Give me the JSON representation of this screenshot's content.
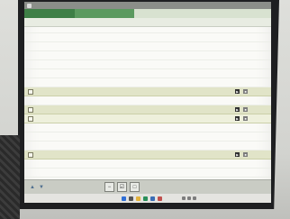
{
  "window": {
    "title": ""
  },
  "tabs": [
    {
      "label": ""
    },
    {
      "label": ""
    }
  ],
  "columns": {
    "c1": "",
    "c2": "",
    "c3": ""
  },
  "rows": [
    {
      "kind": "plain",
      "text": ""
    },
    {
      "kind": "plain",
      "text": ""
    },
    {
      "kind": "plain",
      "text": ""
    },
    {
      "kind": "plain",
      "text": ""
    },
    {
      "kind": "plain",
      "text": ""
    },
    {
      "kind": "plain",
      "text": ""
    },
    {
      "kind": "band",
      "label": "",
      "text": ""
    },
    {
      "kind": "plain",
      "text": ""
    },
    {
      "kind": "band",
      "label": "",
      "text": ""
    },
    {
      "kind": "band",
      "label": "",
      "text": ""
    },
    {
      "kind": "indent",
      "text": ""
    },
    {
      "kind": "indent",
      "text": ""
    },
    {
      "kind": "indent",
      "text": ""
    },
    {
      "kind": "band",
      "label": "",
      "text": ""
    },
    {
      "kind": "indent",
      "text": ""
    },
    {
      "kind": "indent",
      "text": ""
    },
    {
      "kind": "indent",
      "text": ""
    },
    {
      "kind": "band",
      "label": "",
      "text": ""
    },
    {
      "kind": "band",
      "label": "",
      "text": ""
    }
  ],
  "icons": {
    "play": "play-icon",
    "trash": "trash-icon",
    "up": "arrow-up-icon",
    "down": "arrow-down-icon"
  },
  "colors": {
    "tab_active": "#3e7f46",
    "band": "#e1e4c8"
  }
}
